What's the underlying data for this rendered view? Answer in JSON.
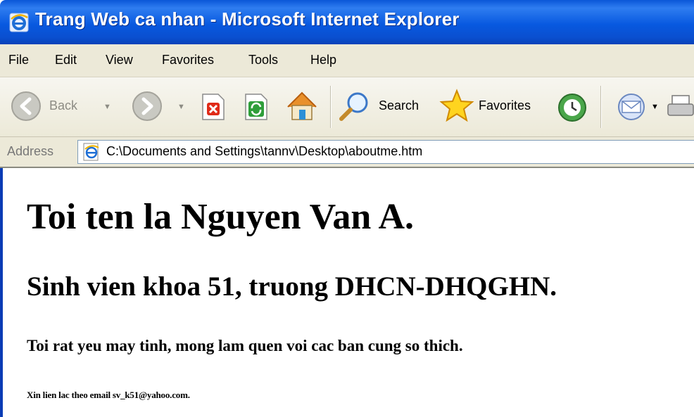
{
  "window": {
    "title": "Trang Web ca nhan - Microsoft Internet Explorer",
    "icon": "ie-icon"
  },
  "menu": {
    "items": [
      "File",
      "Edit",
      "View",
      "Favorites",
      "Tools",
      "Help"
    ]
  },
  "toolbar": {
    "back_label": "Back",
    "search_label": "Search",
    "favorites_label": "Favorites"
  },
  "address": {
    "label": "Address",
    "value": "C:\\Documents and Settings\\tannv\\Desktop\\aboutme.htm"
  },
  "page": {
    "h1": "Toi ten la Nguyen Van A.",
    "h2": "Sinh vien khoa 51, truong DHCN-DHQGHN.",
    "h4": "Toi rat yeu may tinh, mong lam quen voi cac ban cung so thich.",
    "h6": "Xin lien lac theo email sv_k51@yahoo.com."
  },
  "colors": {
    "titlebar": "#0a56d8",
    "chrome": "#ece9d8",
    "accent_border": "#0a3cb5"
  }
}
